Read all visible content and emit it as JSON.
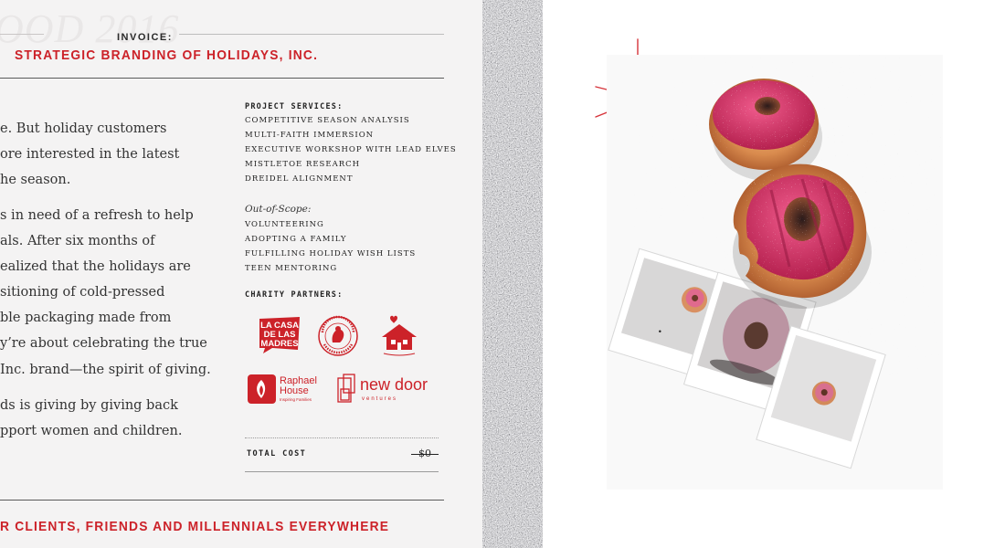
{
  "header": {
    "watermark": "OOD 2016",
    "invoice_label": "INVOICE:",
    "client_name": "STRATEGIC BRANDING OF HOLIDAYS, INC."
  },
  "body_paragraphs": [
    "e. But holiday customers",
    "ore interested in the latest",
    "he season.",
    "s in need of a refresh to help",
    "als.  After six months of",
    "ealized that the holidays are",
    "sitioning of cold-pressed",
    "ble packaging made from",
    "y’re about celebrating the true",
    " Inc. brand—the spirit of giving.",
    "ds is giving by giving back",
    "pport women and children."
  ],
  "project_services": {
    "heading": "PROJECT SERVICES:",
    "items": [
      "COMPETITIVE SEASON ANALYSIS",
      "MULTI-FAITH IMMERSION",
      "EXECUTIVE WORKSHOP WITH LEAD ELVES",
      "MISTLETOE RESEARCH",
      "DREIDEL ALIGNMENT"
    ]
  },
  "out_of_scope": {
    "heading": "Out-of-Scope:",
    "items": [
      "VOLUNTEERING",
      "ADOPTING A FAMILY",
      "FULFILLING HOLIDAY WISH LISTS",
      "TEEN MENTORING"
    ]
  },
  "charity_partners": {
    "heading": "CHARITY PARTNERS:",
    "logos": [
      {
        "name": "la-casa-de-las-madres",
        "line1": "LA CASA",
        "line2": "DE LAS",
        "line3": "MADRES"
      },
      {
        "name": "homeless-prenatal-program",
        "ring_text": "HOMELESS PRENATAL PROGRAM"
      },
      {
        "name": "house-icon-logo"
      },
      {
        "name": "raphael-house",
        "line1": "Raphael",
        "line2": "House",
        "tagline": "Inspiring Families"
      },
      {
        "name": "new-door-ventures",
        "line1": "new door",
        "line2": "ventures"
      }
    ]
  },
  "total": {
    "label": "TOTAL COST",
    "value": "$0"
  },
  "footer": {
    "text": "R CLIENTS, FRIENDS AND MILLENNIALS EVERYWHERE"
  },
  "colors": {
    "accent_red": "#cc2229",
    "paper": "#f4f3f3",
    "ink": "#333333"
  }
}
